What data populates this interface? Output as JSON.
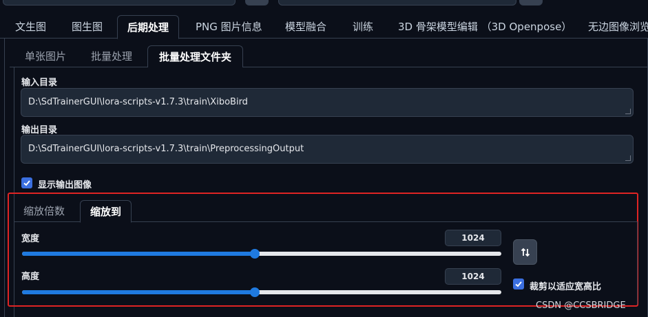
{
  "main_tabs": [
    {
      "label": "文生图"
    },
    {
      "label": "图生图"
    },
    {
      "label": "后期处理"
    },
    {
      "label": "PNG 图片信息"
    },
    {
      "label": "模型融合"
    },
    {
      "label": "训练"
    },
    {
      "label": "3D 骨架模型编辑 （3D Openpose）"
    },
    {
      "label": "无边图像浏览"
    }
  ],
  "active_main_tab": "后期处理",
  "sub_tabs": [
    {
      "label": "单张图片"
    },
    {
      "label": "批量处理"
    },
    {
      "label": "批量处理文件夹"
    }
  ],
  "input_dir": {
    "label": "输入目录",
    "value": "D:\\SdTrainerGUI\\lora-scripts-v1.7.3\\train\\XiboBird"
  },
  "output_dir": {
    "label": "输出目录",
    "value": "D:\\SdTrainerGUI\\lora-scripts-v1.7.3\\train\\PreprocessingOutput"
  },
  "show_output": {
    "label": "显示输出图像",
    "checked": true
  },
  "scale_tabs": [
    {
      "label": "缩放倍数"
    },
    {
      "label": "缩放到"
    }
  ],
  "width": {
    "label": "宽度",
    "value": "1024",
    "fraction": 0.5
  },
  "height": {
    "label": "高度",
    "value": "1024",
    "fraction": 0.5
  },
  "swap_icon": "swap-vertical-icon",
  "crop_to_fit": {
    "label": "裁剪以适应宽高比",
    "checked": true
  },
  "watermark": "CSDN @CCSBRIDGE",
  "colors": {
    "accent": "#1f7ae0",
    "highlight": "#e02424",
    "background": "#0b0f19"
  }
}
